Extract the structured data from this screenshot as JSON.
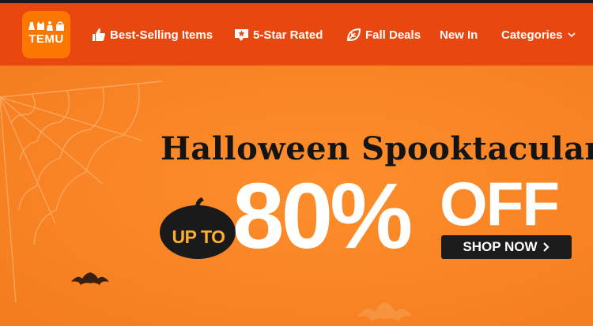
{
  "header": {
    "logo_text": "TEMU",
    "brand_color": "#e8470f",
    "logo_bg": "#fb7701",
    "nav": [
      {
        "label": "Best-Selling Items",
        "icon": "thumbs-up-icon"
      },
      {
        "label": "5-Star Rated",
        "icon": "star-chat-icon"
      },
      {
        "label": "Fall Deals",
        "icon": "leaf-icon"
      },
      {
        "label": "New In",
        "icon": ""
      },
      {
        "label": "Categories",
        "icon": "chevron-down-icon"
      }
    ]
  },
  "hero": {
    "headline": "Halloween Spooktacular",
    "upto": "UP TO",
    "discount": "80%",
    "off": "OFF",
    "cta": "SHOP NOW",
    "bg_color": "#f98425",
    "text_dark": "#141414",
    "upto_color": "#fdb02e"
  }
}
